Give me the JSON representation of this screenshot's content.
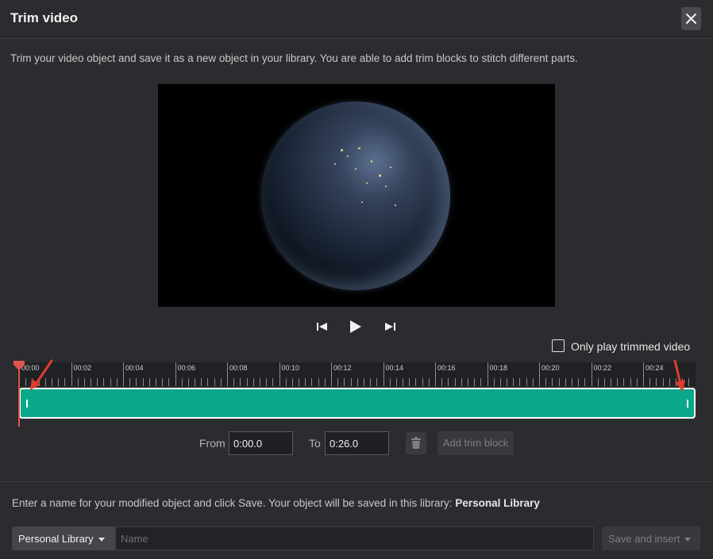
{
  "dialog": {
    "title": "Trim video",
    "close_icon": "close-icon"
  },
  "intro_text": "Trim your video object and save it as a new object in your library. You are able to add trim blocks to stitch different parts.",
  "player": {
    "controls": [
      "skip-to-start-icon",
      "play-icon",
      "skip-to-end-icon"
    ],
    "only_trimmed_label": "Only play trimmed video",
    "only_trimmed_checked": false
  },
  "timeline": {
    "tick_labels": [
      "00:00",
      "00:02",
      "00:04",
      "00:06",
      "00:08",
      "00:10",
      "00:12",
      "00:14",
      "00:16",
      "00:18",
      "00:20",
      "00:22",
      "00:24"
    ],
    "trim_block_color": "#0aa88a",
    "playhead_color": "#e0544e"
  },
  "trim": {
    "from_label": "From",
    "from_value": "0:00.0",
    "to_label": "To",
    "to_value": "0:26.0",
    "delete_icon": "trash-icon",
    "add_label": "Add trim block"
  },
  "save": {
    "note_prefix": "Enter a name for your modified object and click Save. Your object will be saved in this library:",
    "library_name": "Personal Library",
    "library_select": "Personal Library",
    "name_placeholder": "Name",
    "button_label": "Save and insert"
  }
}
